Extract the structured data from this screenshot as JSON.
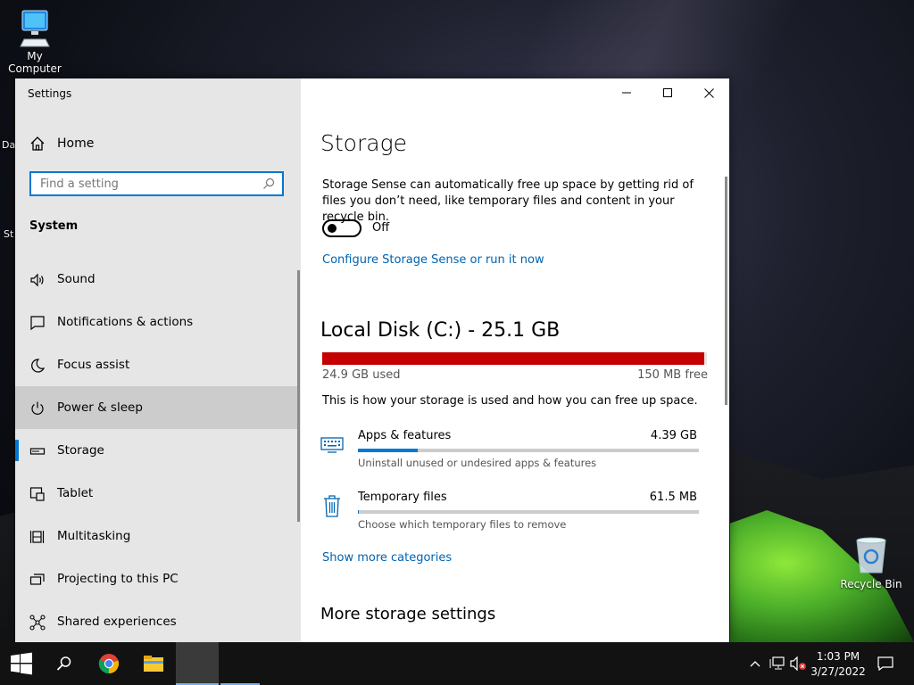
{
  "desktop": {
    "icons": [
      {
        "label": "My Computer"
      },
      {
        "label": "Recycle Bin"
      }
    ],
    "partial_labels": [
      "Da",
      "St"
    ]
  },
  "window": {
    "title": "Settings",
    "controls": {
      "minimize": "minimize",
      "maximize": "maximize",
      "close": "close"
    }
  },
  "sidebar": {
    "home_label": "Home",
    "search": {
      "placeholder": "Find a setting",
      "value": ""
    },
    "section": "System",
    "items": [
      {
        "label": "Sound",
        "icon": "speaker-icon"
      },
      {
        "label": "Notifications & actions",
        "icon": "notification-icon"
      },
      {
        "label": "Focus assist",
        "icon": "moon-icon"
      },
      {
        "label": "Power & sleep",
        "icon": "power-icon",
        "hover": true
      },
      {
        "label": "Storage",
        "icon": "storage-icon",
        "selected": true
      },
      {
        "label": "Tablet",
        "icon": "tablet-icon"
      },
      {
        "label": "Multitasking",
        "icon": "multitasking-icon"
      },
      {
        "label": "Projecting to this PC",
        "icon": "projecting-icon"
      },
      {
        "label": "Shared experiences",
        "icon": "shared-icon"
      }
    ]
  },
  "main": {
    "title": "Storage",
    "storage_sense_desc": "Storage Sense can automatically free up space by getting rid of files you don’t need, like temporary files and content in your recycle bin.",
    "toggle": {
      "state": "Off",
      "on": false
    },
    "configure_link": "Configure Storage Sense or run it now",
    "disk": {
      "title": "Local Disk (C:) - 25.1 GB",
      "used": "24.9 GB used",
      "free": "150 MB free",
      "used_fraction": 0.992
    },
    "usage_desc": "This is how your storage is used and how you can free up space.",
    "categories": [
      {
        "name": "Apps & features",
        "size": "4.39 GB",
        "desc": "Uninstall unused or undesired apps & features",
        "fraction": 0.175,
        "icon": "apps-icon"
      },
      {
        "name": "Temporary files",
        "size": "61.5 MB",
        "desc": "Choose which temporary files to remove",
        "fraction": 0.0025,
        "icon": "trash-icon"
      }
    ],
    "show_more_link": "Show more categories",
    "more_settings_heading": "More storage settings"
  },
  "taskbar": {
    "apps": [
      "start-icon",
      "search-icon",
      "chrome-icon",
      "file-explorer-icon",
      "active-window"
    ],
    "clock": {
      "time": "1:03 PM",
      "date": "3/27/2022"
    }
  },
  "colors": {
    "accent": "#0078d4",
    "link": "#0063b1",
    "disk_bar": "#c50000"
  }
}
